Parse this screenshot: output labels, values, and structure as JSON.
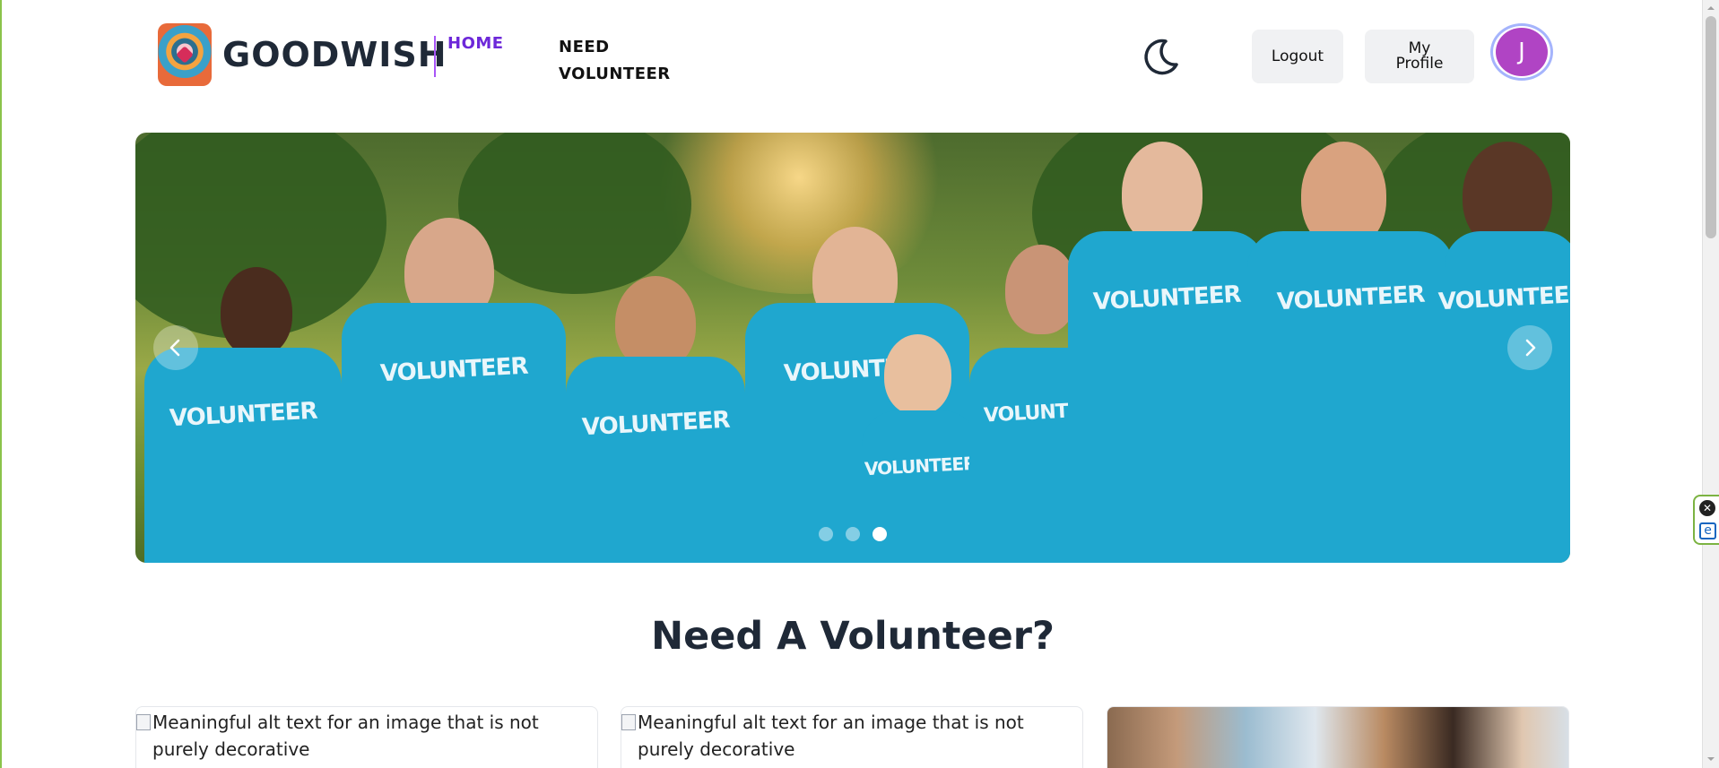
{
  "header": {
    "brand_name": "GOODWISH",
    "nav": {
      "home_label": "HOME",
      "need_volunteer_label": "NEED VOLUNTEER"
    },
    "theme_toggle_icon": "moon-icon",
    "logout_label": "Logout",
    "my_profile_label": "My Profile",
    "avatar_initial": "J"
  },
  "hero": {
    "shirt_text": "VOLUNTEER",
    "slide_count": 3,
    "active_slide": 3,
    "prev_icon": "chevron-left-icon",
    "next_icon": "chevron-right-icon"
  },
  "section": {
    "title": "Need A Volunteer?"
  },
  "cards": [
    {
      "alt_text": "Meaningful alt text for an image that is not purely decorative"
    },
    {
      "alt_text": "Meaningful alt text for an image that is not purely decorative"
    },
    {
      "alt_text": ""
    }
  ],
  "colors": {
    "accent_purple": "#6d28d9",
    "avatar_bg": "#b044c4",
    "shirt_blue": "#1fa7cf"
  }
}
